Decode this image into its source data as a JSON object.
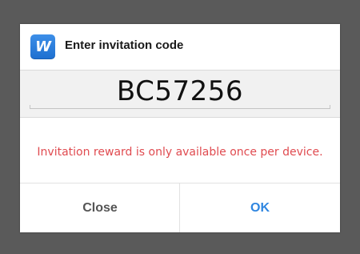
{
  "dialog": {
    "title": "Enter invitation code",
    "app_icon_letter": "W",
    "app_icon_name": "app-logo-icon",
    "code_value": "BC57256",
    "message": "Invitation reward is only available once per device.",
    "close_label": "Close",
    "ok_label": "OK"
  },
  "colors": {
    "message": "#e04b50",
    "ok_button": "#2f86e0",
    "icon": "#2a7de0"
  }
}
